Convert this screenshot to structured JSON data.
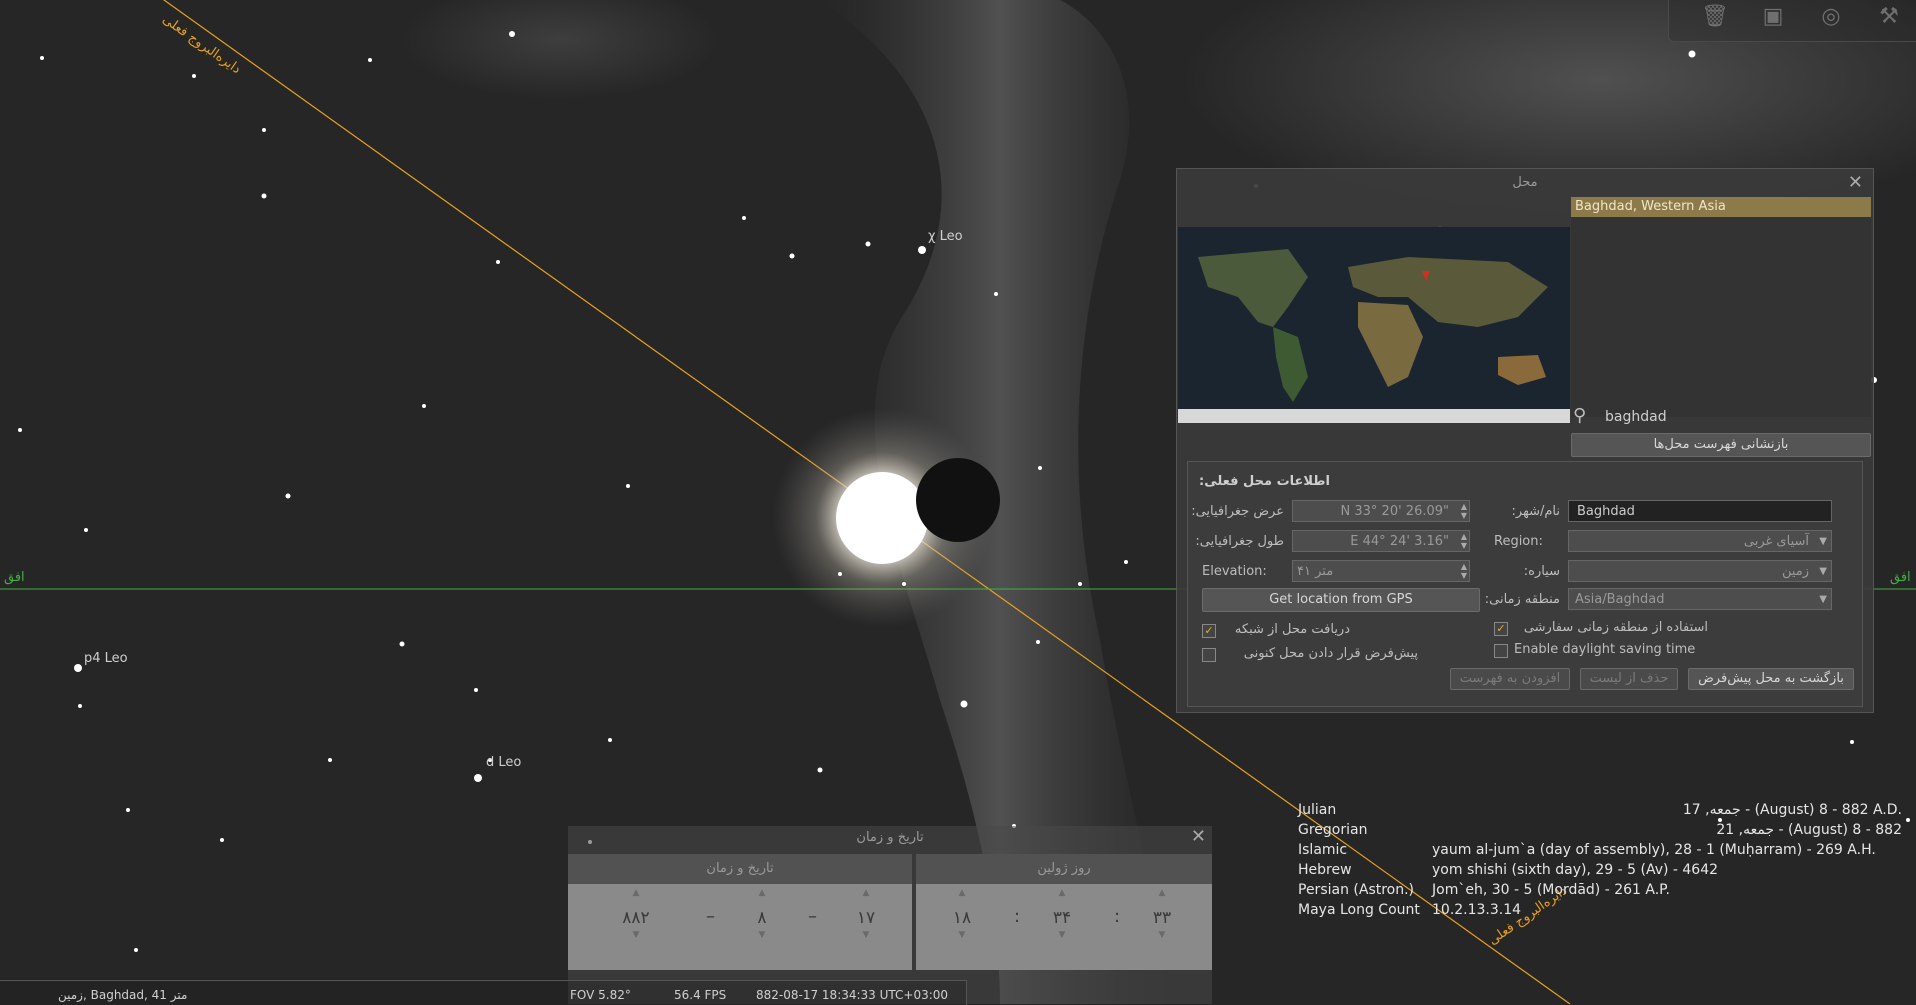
{
  "toolbar": {
    "icons": [
      "trash-icon",
      "tv-icon",
      "target-icon",
      "wrench-icon"
    ]
  },
  "sky": {
    "star_labels": {
      "chi_leo": "χ Leo",
      "p4_leo": "p4 Leo",
      "d_leo": "d Leo"
    },
    "ecliptic_label": "دایره‌البروج فعلی",
    "horizon_label": "افق"
  },
  "location_window": {
    "title": "محل",
    "selected_location": "Baghdad, Western Asia",
    "search_value": "baghdad",
    "reset_list_button": "بازنشانی فهرست محل‌ها",
    "section_title": "اطلاعات محل فعلی:",
    "labels": {
      "latitude": "عرض جغرافیایی:",
      "longitude": "طول جغرافیایی:",
      "elevation": "Elevation:",
      "name_city": "نام/شهر:",
      "region": "Region:",
      "planet": "سیاره:",
      "timezone": "منطقه زمانی:"
    },
    "values": {
      "latitude": "N 33° 20' 26.09\"",
      "longitude": "E 44° 24' 3.16\"",
      "elevation": "۴۱ متر",
      "name_city": "Baghdad",
      "region": "آسیای غربی",
      "planet": "زمین",
      "timezone": "Asia/Baghdad"
    },
    "gps_button": "Get location from GPS",
    "checkboxes": {
      "network_location": {
        "label": "دریافت محل از شبکه",
        "checked": true
      },
      "set_default": {
        "label": "پیش‌فرض قرار دادن محل کنونی",
        "checked": false
      },
      "use_custom_tz": {
        "label": "استفاده از منطقه زمانی سفارشی",
        "checked": true
      },
      "daylight_saving": {
        "label": "Enable daylight saving time",
        "checked": false
      }
    },
    "buttons": {
      "add_to_list": "افزودن به فهرست",
      "delete_from_list": "حذف از لیست",
      "return_default": "بازگشت به محل پیش‌فرض"
    }
  },
  "datetime_window": {
    "title": "تاریخ و زمان",
    "tab_date": "تاریخ و زمان",
    "tab_julian": "روز ژولین",
    "year": "۸۸۲",
    "month": "۸",
    "day": "۱۷",
    "hour": "۱۸",
    "minute": "۳۴",
    "second": "۳۳",
    "date_sep": "–",
    "time_sep": ":"
  },
  "calendars": [
    {
      "name": "Julian",
      "value": "جمعه, 17 - (August) 8 - 882 A.D."
    },
    {
      "name": "Gregorian",
      "value": "جمعه, 21 - (August) 8 - 882"
    },
    {
      "name": "Islamic",
      "value": "yaum al-jum`a (day of assembly), 28 - 1 (Muḥarram) - 269 A.H."
    },
    {
      "name": "Hebrew",
      "value": "yom shishi (sixth day), 29 - 5 (Av) - 4642"
    },
    {
      "name": "Persian (Astron.)",
      "value": "Jom`eh, 30 - 5 (Mordād) - 261 A.P."
    },
    {
      "name": "Maya Long Count",
      "value": "10.2.13.3.14"
    }
  ],
  "statusbar": {
    "location": "زمین, Baghdad, 41 متر",
    "fov": "FOV 5.82°",
    "fps": "56.4 FPS",
    "datetime": "882-08-17 18:34:33 UTC+03:00"
  },
  "colors": {
    "ecliptic": "#e8a020",
    "horizon": "#40b040",
    "selected_row": "#8d7a4a"
  }
}
